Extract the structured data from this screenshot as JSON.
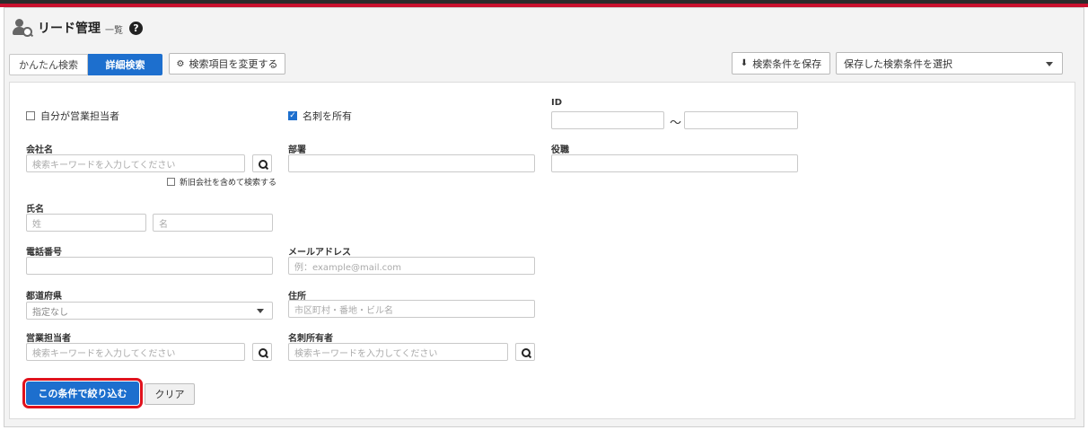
{
  "header": {
    "title": "リード管理",
    "subtitle": "一覧",
    "help": "?"
  },
  "tabs": [
    {
      "label": "かんたん検索",
      "active": false
    },
    {
      "label": "詳細検索",
      "active": true
    }
  ],
  "toolbar": {
    "change_fields_label": "検索項目を変更する",
    "save_conditions_label": "検索条件を保存",
    "saved_select_value": "保存した検索条件を選択"
  },
  "form": {
    "own_sales_label": "自分が営業担当者",
    "own_sales_checked": false,
    "has_card_label": "名刺を所有",
    "has_card_checked": true,
    "id_label": "ID",
    "id_tilde": "〜",
    "company_label": "会社名",
    "company_placeholder": "検索キーワードを入力してください",
    "include_old_company_label": "新旧会社を含めて検索する",
    "department_label": "部署",
    "position_label": "役職",
    "name_label": "氏名",
    "last_name_placeholder": "姓",
    "first_name_placeholder": "名",
    "phone_label": "電話番号",
    "email_label": "メールアドレス",
    "email_placeholder": "例：example@mail.com",
    "prefecture_label": "都道府県",
    "prefecture_value": "指定なし",
    "address_label": "住所",
    "address_placeholder": "市区町村・番地・ビル名",
    "sales_rep_label": "営業担当者",
    "sales_rep_placeholder": "検索キーワードを入力してください",
    "card_owner_label": "名刺所有者",
    "card_owner_placeholder": "検索キーワードを入力してください"
  },
  "actions": {
    "filter_label": "この条件で絞り込む",
    "clear_label": "クリア"
  },
  "colors": {
    "accent": "#1d6fce",
    "highlight": "#e0121d",
    "top_bar": "#c8102e"
  }
}
